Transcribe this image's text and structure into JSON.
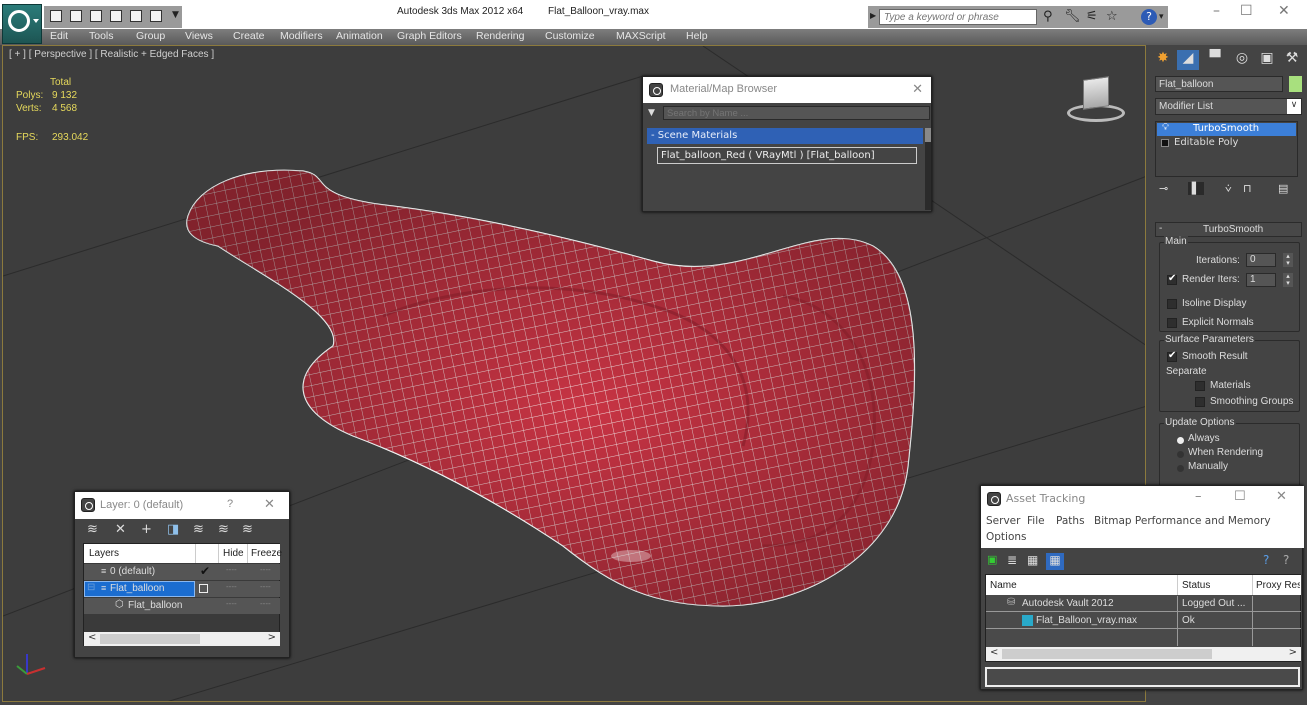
{
  "app": {
    "title": "Autodesk 3ds Max  2012 x64",
    "file": "Flat_Balloon_vray.max",
    "search_placeholder": "Type a keyword or phrase"
  },
  "icons": {
    "app_menu": "3ds-max-logo-icon",
    "qat": [
      "open-icon",
      "save-icon",
      "undo-icon",
      "redo-icon",
      "hold-icon",
      "fetch-icon"
    ],
    "search_tools": [
      "binoculars-icon",
      "wrench-icon",
      "satellite-icon",
      "star-icon",
      "help-icon"
    ]
  },
  "window": {
    "minimize": "–",
    "maximize": "☐",
    "close": "✕"
  },
  "menu": [
    "Edit",
    "Tools",
    "Group",
    "Views",
    "Create",
    "Modifiers",
    "Animation",
    "Graph Editors",
    "Rendering",
    "Customize",
    "MAXScript",
    "Help"
  ],
  "viewport": {
    "label": "[ + ] [ Perspective ] [ Realistic + Edged Faces ]",
    "stats": {
      "total_label": "Total",
      "polys_label": "Polys:",
      "polys": "9 132",
      "verts_label": "Verts:",
      "verts": "4 568",
      "fps_label": "FPS:",
      "fps": "293.042"
    },
    "object_color": "#c4303f",
    "wire_color": "#ffffff"
  },
  "material_browser": {
    "title": "Material/Map Browser",
    "close": "✕",
    "search_placeholder": "Search by Name ...",
    "group": "- Scene Materials",
    "items": [
      "Flat_balloon_Red ( VRayMtl ) [Flat_balloon]"
    ]
  },
  "command_panel": {
    "object_name": "Flat_balloon",
    "object_color": "#a8e07e",
    "modifier_list": "Modifier List",
    "stack": [
      {
        "label": "TurboSmooth",
        "selected": true
      },
      {
        "label": "Editable Poly",
        "selected": false
      }
    ],
    "rollout": {
      "title": "TurboSmooth",
      "collapse": "-",
      "main_label": "Main",
      "iterations_label": "Iterations:",
      "iterations": "0",
      "render_iters_label": "Render Iters:",
      "render_iters": "1",
      "render_iters_checked": true,
      "isoline_label": "Isoline Display",
      "isoline_checked": false,
      "explicit_normals_label": "Explicit Normals",
      "explicit_normals_checked": false,
      "surface_label": "Surface Parameters",
      "smooth_result_label": "Smooth Result",
      "smooth_result_checked": true,
      "separate_label": "Separate",
      "materials_label": "Materials",
      "materials_checked": false,
      "smoothing_groups_label": "Smoothing Groups",
      "smoothing_groups_checked": false,
      "update_label": "Update Options",
      "update_options": [
        "Always",
        "When Rendering",
        "Manually"
      ],
      "update_selected": "Always"
    }
  },
  "layer_dialog": {
    "title": "Layer: 0 (default)",
    "help": "?",
    "close": "✕",
    "columns": [
      "Layers",
      "",
      "Hide",
      "Freeze"
    ],
    "rows": [
      {
        "name": "0 (default)",
        "check": "✔",
        "hide": "----",
        "freeze": "----",
        "selected": false
      },
      {
        "name": "Flat_balloon",
        "check": "",
        "hide": "----",
        "freeze": "----",
        "selected": true
      },
      {
        "name": "Flat_balloon",
        "check": "",
        "hide": "----",
        "freeze": "----",
        "selected": false
      }
    ]
  },
  "asset_tracking": {
    "title": "Asset Tracking",
    "menu": [
      "Server",
      "File",
      "Paths",
      "Bitmap Performance and Memory",
      "Options"
    ],
    "columns": [
      "Name",
      "Status",
      "Proxy Res"
    ],
    "rows": [
      {
        "name": "Autodesk Vault 2012",
        "status": "Logged Out ..."
      },
      {
        "name": "Flat_Balloon_vray.max",
        "status": "Ok"
      }
    ]
  }
}
